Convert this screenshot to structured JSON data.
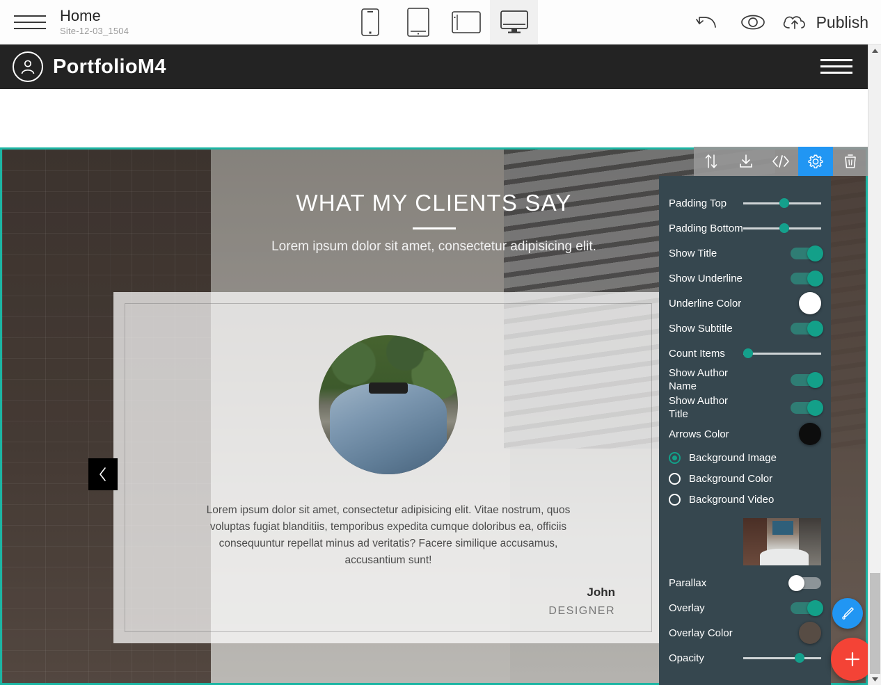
{
  "editor": {
    "menu_icon": "hamburger-icon",
    "page_title": "Home",
    "site_name": "Site-12-03_1504",
    "devices": [
      {
        "name": "mobile",
        "label": "Mobile",
        "active": false
      },
      {
        "name": "tablet",
        "label": "Tablet",
        "active": false
      },
      {
        "name": "tablet-landscape",
        "label": "Tablet Landscape",
        "active": false
      },
      {
        "name": "desktop",
        "label": "Desktop",
        "active": true
      }
    ],
    "tools": {
      "undo": "undo-icon",
      "preview": "eye-icon",
      "publish_icon": "cloud-upload-icon",
      "publish_label": "Publish"
    }
  },
  "site": {
    "brand_name": "PortfolioM4",
    "brand_icon": "user-avatar-icon",
    "nav_toggle": "hamburger-icon"
  },
  "block": {
    "title": "WHAT MY CLIENTS SAY",
    "subtitle": "Lorem ipsum dolor sit amet, consectetur adipisicing elit.",
    "quote": "Lorem ipsum dolor sit amet, consectetur adipisicing elit. Vitae nostrum, quos voluptas fugiat blanditiis, temporibus expedita cumque doloribus ea, officiis consequuntur repellat minus ad veritatis? Facere similique accusamus, accusantium sunt!",
    "author_name": "John",
    "author_title": "DESIGNER",
    "prev_arrow": "chevron-left-icon",
    "selection_color": "#1cb5a3"
  },
  "block_toolbar": [
    {
      "name": "move-block",
      "icon": "arrows-up-down-icon",
      "active": false
    },
    {
      "name": "download-block",
      "icon": "download-icon",
      "active": false
    },
    {
      "name": "edit-code",
      "icon": "code-icon",
      "active": false
    },
    {
      "name": "block-settings",
      "icon": "gear-icon",
      "active": true
    },
    {
      "name": "delete-block",
      "icon": "trash-icon",
      "active": false
    }
  ],
  "panel": {
    "accent_color": "#13a089",
    "background_color": "#36474f",
    "rows": [
      {
        "label": "Padding Top",
        "type": "slider",
        "value": 46
      },
      {
        "label": "Padding Bottom",
        "type": "slider",
        "value": 46
      },
      {
        "label": "Show Title",
        "type": "toggle",
        "value": true
      },
      {
        "label": "Show Underline",
        "type": "toggle",
        "value": true
      },
      {
        "label": "Underline Color",
        "type": "color",
        "value": "#ffffff"
      },
      {
        "label": "Show Subtitle",
        "type": "toggle",
        "value": true
      },
      {
        "label": "Count Items",
        "type": "slider",
        "value": 2
      },
      {
        "label": "Show Author Name",
        "type": "toggle",
        "value": true
      },
      {
        "label": "Show Author Title",
        "type": "toggle",
        "value": true
      },
      {
        "label": "Arrows Color",
        "type": "color",
        "value": "#0d0d0d"
      }
    ],
    "background_options": [
      {
        "label": "Background Image",
        "selected": true
      },
      {
        "label": "Background Color",
        "selected": false
      },
      {
        "label": "Background Video",
        "selected": false
      }
    ],
    "thumbnail_name": "background-image-thumbnail",
    "rows_bottom": [
      {
        "label": "Parallax",
        "type": "toggle",
        "value": false
      },
      {
        "label": "Overlay",
        "type": "toggle",
        "value": true
      },
      {
        "label": "Overlay Color",
        "type": "color",
        "value": "#574c44"
      },
      {
        "label": "Opacity",
        "type": "slider",
        "value": 66
      }
    ]
  },
  "fabs": {
    "style_icon": "brush-icon",
    "add_icon": "plus-icon"
  },
  "scrollbar": {
    "up_icon": "caret-up-icon",
    "down_icon": "caret-down-icon"
  }
}
